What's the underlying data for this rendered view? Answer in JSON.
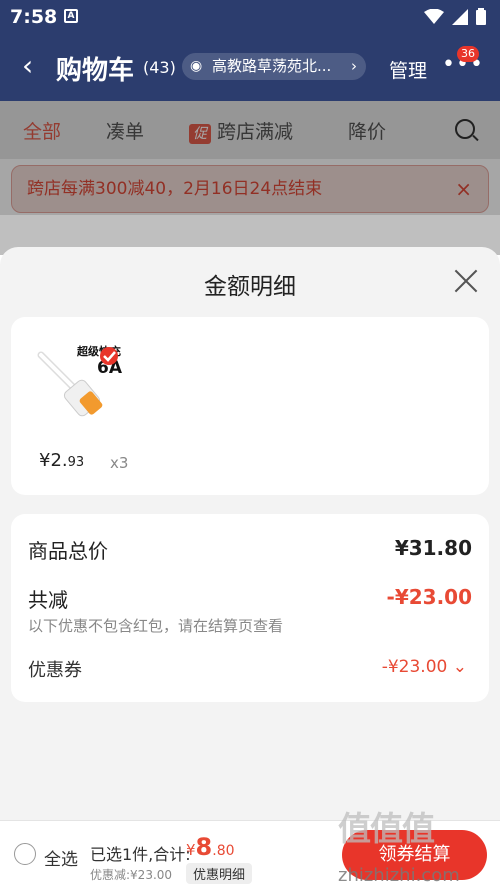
{
  "status": {
    "time": "7:58",
    "notif": "A"
  },
  "nav": {
    "back": "‹",
    "title": "购物车",
    "count": "(43)",
    "location": "高教路草荡苑北...",
    "manage": "管理",
    "more": "•••",
    "badge": "36"
  },
  "tabs": [
    {
      "label": "全部"
    },
    {
      "label": "凑单"
    },
    {
      "label": "跨店满减",
      "tag": "促"
    },
    {
      "label": "降价"
    }
  ],
  "notice": {
    "text": "跨店每满300减40，2月16日24点结束",
    "close": "×"
  },
  "sheet": {
    "title": "金额明细",
    "product": {
      "price_main": "¥2.",
      "price_dec": "93",
      "qty": "x3",
      "img_text_1": "超级快充",
      "img_text_2": "6A"
    },
    "summary": {
      "total_label": "商品总价",
      "total_value": "¥31.80",
      "reduce_label": "共减",
      "reduce_value": "-¥23.00",
      "hint": "以下优惠不包含红包，请在结算页查看",
      "coupon_label": "优惠券",
      "coupon_value": "-¥23.00"
    }
  },
  "bottom": {
    "select_all": "全选",
    "selected": "已选1件,合计:",
    "currency": "¥",
    "amount_int": "8",
    "amount_dec": ".80",
    "discount": "优惠减:¥23.00",
    "detail_btn": "优惠明细",
    "pay": "领券结算"
  },
  "watermark": {
    "text": "值值值",
    "site": "zhizhizhi.com"
  },
  "colors": {
    "brand_dark": "#2c3d6e",
    "accent": "#e84a35"
  }
}
